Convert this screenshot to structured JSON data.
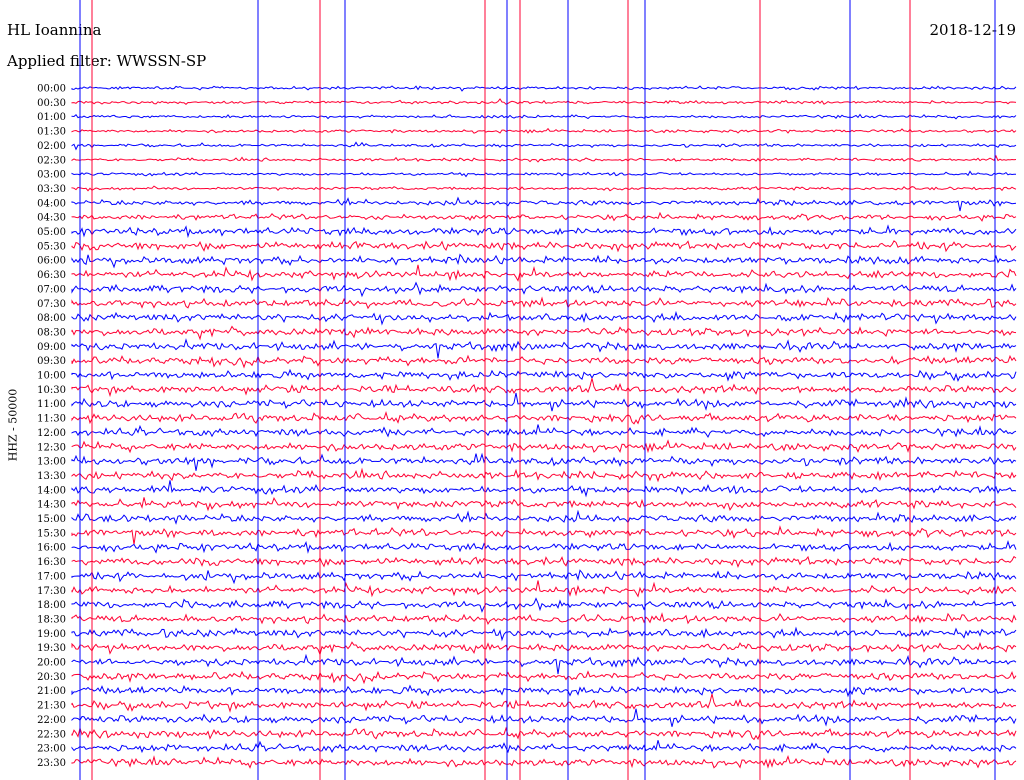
{
  "header": {
    "station": "HL Ioannina",
    "filter": "Applied filter: WWSSN-SP",
    "date": "2018-12-19"
  },
  "chart_data": {
    "type": "helicorder",
    "title": "HL Ioannina",
    "ylabel": "HHZ - 50000",
    "row_labels": [
      "00:00",
      "00:30",
      "01:00",
      "01:30",
      "02:00",
      "02:30",
      "03:00",
      "03:30",
      "04:00",
      "04:30",
      "05:00",
      "05:30",
      "06:00",
      "06:30",
      "07:00",
      "07:30",
      "08:00",
      "08:30",
      "09:00",
      "09:30",
      "10:00",
      "10:30",
      "11:00",
      "11:30",
      "12:00",
      "12:30",
      "13:00",
      "13:30",
      "14:00",
      "14:30",
      "15:00",
      "15:30",
      "16:00",
      "16:30",
      "17:00",
      "17:30",
      "18:00",
      "18:30",
      "19:00",
      "19:30",
      "20:00",
      "20:30",
      "21:00",
      "21:30",
      "22:00",
      "22:30",
      "23:00",
      "23:30"
    ],
    "trace_colors": [
      "#0000ff",
      "#ff0033"
    ],
    "background": "#ffffff",
    "minutes_per_row": 30
  }
}
